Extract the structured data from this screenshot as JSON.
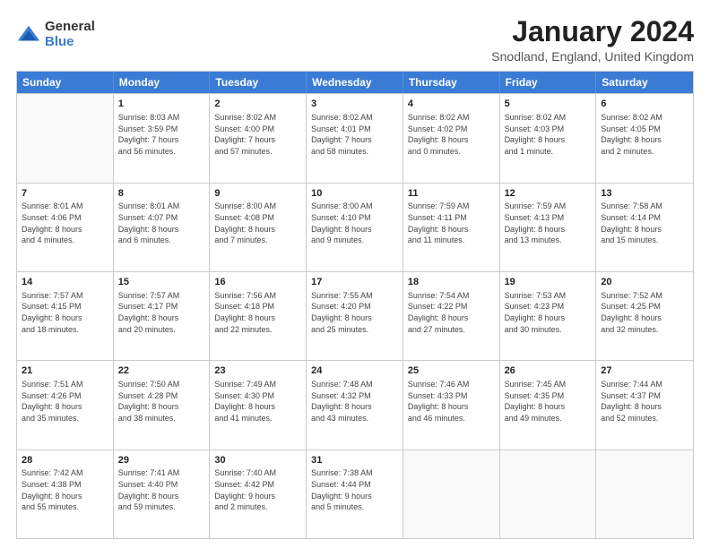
{
  "logo": {
    "general": "General",
    "blue": "Blue"
  },
  "title": "January 2024",
  "subtitle": "Snodland, England, United Kingdom",
  "headers": [
    "Sunday",
    "Monday",
    "Tuesday",
    "Wednesday",
    "Thursday",
    "Friday",
    "Saturday"
  ],
  "rows": [
    [
      {
        "day": "",
        "info": ""
      },
      {
        "day": "1",
        "info": "Sunrise: 8:03 AM\nSunset: 3:59 PM\nDaylight: 7 hours\nand 56 minutes."
      },
      {
        "day": "2",
        "info": "Sunrise: 8:02 AM\nSunset: 4:00 PM\nDaylight: 7 hours\nand 57 minutes."
      },
      {
        "day": "3",
        "info": "Sunrise: 8:02 AM\nSunset: 4:01 PM\nDaylight: 7 hours\nand 58 minutes."
      },
      {
        "day": "4",
        "info": "Sunrise: 8:02 AM\nSunset: 4:02 PM\nDaylight: 8 hours\nand 0 minutes."
      },
      {
        "day": "5",
        "info": "Sunrise: 8:02 AM\nSunset: 4:03 PM\nDaylight: 8 hours\nand 1 minute."
      },
      {
        "day": "6",
        "info": "Sunrise: 8:02 AM\nSunset: 4:05 PM\nDaylight: 8 hours\nand 2 minutes."
      }
    ],
    [
      {
        "day": "7",
        "info": "Sunrise: 8:01 AM\nSunset: 4:06 PM\nDaylight: 8 hours\nand 4 minutes."
      },
      {
        "day": "8",
        "info": "Sunrise: 8:01 AM\nSunset: 4:07 PM\nDaylight: 8 hours\nand 6 minutes."
      },
      {
        "day": "9",
        "info": "Sunrise: 8:00 AM\nSunset: 4:08 PM\nDaylight: 8 hours\nand 7 minutes."
      },
      {
        "day": "10",
        "info": "Sunrise: 8:00 AM\nSunset: 4:10 PM\nDaylight: 8 hours\nand 9 minutes."
      },
      {
        "day": "11",
        "info": "Sunrise: 7:59 AM\nSunset: 4:11 PM\nDaylight: 8 hours\nand 11 minutes."
      },
      {
        "day": "12",
        "info": "Sunrise: 7:59 AM\nSunset: 4:13 PM\nDaylight: 8 hours\nand 13 minutes."
      },
      {
        "day": "13",
        "info": "Sunrise: 7:58 AM\nSunset: 4:14 PM\nDaylight: 8 hours\nand 15 minutes."
      }
    ],
    [
      {
        "day": "14",
        "info": "Sunrise: 7:57 AM\nSunset: 4:15 PM\nDaylight: 8 hours\nand 18 minutes."
      },
      {
        "day": "15",
        "info": "Sunrise: 7:57 AM\nSunset: 4:17 PM\nDaylight: 8 hours\nand 20 minutes."
      },
      {
        "day": "16",
        "info": "Sunrise: 7:56 AM\nSunset: 4:18 PM\nDaylight: 8 hours\nand 22 minutes."
      },
      {
        "day": "17",
        "info": "Sunrise: 7:55 AM\nSunset: 4:20 PM\nDaylight: 8 hours\nand 25 minutes."
      },
      {
        "day": "18",
        "info": "Sunrise: 7:54 AM\nSunset: 4:22 PM\nDaylight: 8 hours\nand 27 minutes."
      },
      {
        "day": "19",
        "info": "Sunrise: 7:53 AM\nSunset: 4:23 PM\nDaylight: 8 hours\nand 30 minutes."
      },
      {
        "day": "20",
        "info": "Sunrise: 7:52 AM\nSunset: 4:25 PM\nDaylight: 8 hours\nand 32 minutes."
      }
    ],
    [
      {
        "day": "21",
        "info": "Sunrise: 7:51 AM\nSunset: 4:26 PM\nDaylight: 8 hours\nand 35 minutes."
      },
      {
        "day": "22",
        "info": "Sunrise: 7:50 AM\nSunset: 4:28 PM\nDaylight: 8 hours\nand 38 minutes."
      },
      {
        "day": "23",
        "info": "Sunrise: 7:49 AM\nSunset: 4:30 PM\nDaylight: 8 hours\nand 41 minutes."
      },
      {
        "day": "24",
        "info": "Sunrise: 7:48 AM\nSunset: 4:32 PM\nDaylight: 8 hours\nand 43 minutes."
      },
      {
        "day": "25",
        "info": "Sunrise: 7:46 AM\nSunset: 4:33 PM\nDaylight: 8 hours\nand 46 minutes."
      },
      {
        "day": "26",
        "info": "Sunrise: 7:45 AM\nSunset: 4:35 PM\nDaylight: 8 hours\nand 49 minutes."
      },
      {
        "day": "27",
        "info": "Sunrise: 7:44 AM\nSunset: 4:37 PM\nDaylight: 8 hours\nand 52 minutes."
      }
    ],
    [
      {
        "day": "28",
        "info": "Sunrise: 7:42 AM\nSunset: 4:38 PM\nDaylight: 8 hours\nand 55 minutes."
      },
      {
        "day": "29",
        "info": "Sunrise: 7:41 AM\nSunset: 4:40 PM\nDaylight: 8 hours\nand 59 minutes."
      },
      {
        "day": "30",
        "info": "Sunrise: 7:40 AM\nSunset: 4:42 PM\nDaylight: 9 hours\nand 2 minutes."
      },
      {
        "day": "31",
        "info": "Sunrise: 7:38 AM\nSunset: 4:44 PM\nDaylight: 9 hours\nand 5 minutes."
      },
      {
        "day": "",
        "info": ""
      },
      {
        "day": "",
        "info": ""
      },
      {
        "day": "",
        "info": ""
      }
    ]
  ]
}
